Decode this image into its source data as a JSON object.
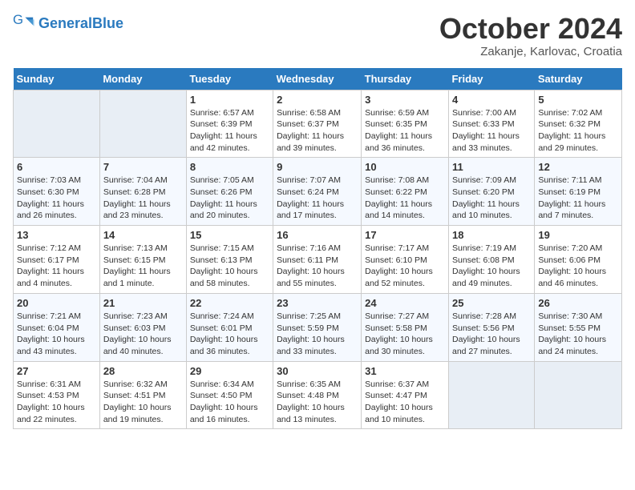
{
  "header": {
    "logo_general": "General",
    "logo_blue": "Blue",
    "month": "October 2024",
    "location": "Zakanje, Karlovac, Croatia"
  },
  "days_of_week": [
    "Sunday",
    "Monday",
    "Tuesday",
    "Wednesday",
    "Thursday",
    "Friday",
    "Saturday"
  ],
  "weeks": [
    [
      {
        "day": "",
        "info": ""
      },
      {
        "day": "",
        "info": ""
      },
      {
        "day": "1",
        "info": "Sunrise: 6:57 AM\nSunset: 6:39 PM\nDaylight: 11 hours and 42 minutes."
      },
      {
        "day": "2",
        "info": "Sunrise: 6:58 AM\nSunset: 6:37 PM\nDaylight: 11 hours and 39 minutes."
      },
      {
        "day": "3",
        "info": "Sunrise: 6:59 AM\nSunset: 6:35 PM\nDaylight: 11 hours and 36 minutes."
      },
      {
        "day": "4",
        "info": "Sunrise: 7:00 AM\nSunset: 6:33 PM\nDaylight: 11 hours and 33 minutes."
      },
      {
        "day": "5",
        "info": "Sunrise: 7:02 AM\nSunset: 6:32 PM\nDaylight: 11 hours and 29 minutes."
      }
    ],
    [
      {
        "day": "6",
        "info": "Sunrise: 7:03 AM\nSunset: 6:30 PM\nDaylight: 11 hours and 26 minutes."
      },
      {
        "day": "7",
        "info": "Sunrise: 7:04 AM\nSunset: 6:28 PM\nDaylight: 11 hours and 23 minutes."
      },
      {
        "day": "8",
        "info": "Sunrise: 7:05 AM\nSunset: 6:26 PM\nDaylight: 11 hours and 20 minutes."
      },
      {
        "day": "9",
        "info": "Sunrise: 7:07 AM\nSunset: 6:24 PM\nDaylight: 11 hours and 17 minutes."
      },
      {
        "day": "10",
        "info": "Sunrise: 7:08 AM\nSunset: 6:22 PM\nDaylight: 11 hours and 14 minutes."
      },
      {
        "day": "11",
        "info": "Sunrise: 7:09 AM\nSunset: 6:20 PM\nDaylight: 11 hours and 10 minutes."
      },
      {
        "day": "12",
        "info": "Sunrise: 7:11 AM\nSunset: 6:19 PM\nDaylight: 11 hours and 7 minutes."
      }
    ],
    [
      {
        "day": "13",
        "info": "Sunrise: 7:12 AM\nSunset: 6:17 PM\nDaylight: 11 hours and 4 minutes."
      },
      {
        "day": "14",
        "info": "Sunrise: 7:13 AM\nSunset: 6:15 PM\nDaylight: 11 hours and 1 minute."
      },
      {
        "day": "15",
        "info": "Sunrise: 7:15 AM\nSunset: 6:13 PM\nDaylight: 10 hours and 58 minutes."
      },
      {
        "day": "16",
        "info": "Sunrise: 7:16 AM\nSunset: 6:11 PM\nDaylight: 10 hours and 55 minutes."
      },
      {
        "day": "17",
        "info": "Sunrise: 7:17 AM\nSunset: 6:10 PM\nDaylight: 10 hours and 52 minutes."
      },
      {
        "day": "18",
        "info": "Sunrise: 7:19 AM\nSunset: 6:08 PM\nDaylight: 10 hours and 49 minutes."
      },
      {
        "day": "19",
        "info": "Sunrise: 7:20 AM\nSunset: 6:06 PM\nDaylight: 10 hours and 46 minutes."
      }
    ],
    [
      {
        "day": "20",
        "info": "Sunrise: 7:21 AM\nSunset: 6:04 PM\nDaylight: 10 hours and 43 minutes."
      },
      {
        "day": "21",
        "info": "Sunrise: 7:23 AM\nSunset: 6:03 PM\nDaylight: 10 hours and 40 minutes."
      },
      {
        "day": "22",
        "info": "Sunrise: 7:24 AM\nSunset: 6:01 PM\nDaylight: 10 hours and 36 minutes."
      },
      {
        "day": "23",
        "info": "Sunrise: 7:25 AM\nSunset: 5:59 PM\nDaylight: 10 hours and 33 minutes."
      },
      {
        "day": "24",
        "info": "Sunrise: 7:27 AM\nSunset: 5:58 PM\nDaylight: 10 hours and 30 minutes."
      },
      {
        "day": "25",
        "info": "Sunrise: 7:28 AM\nSunset: 5:56 PM\nDaylight: 10 hours and 27 minutes."
      },
      {
        "day": "26",
        "info": "Sunrise: 7:30 AM\nSunset: 5:55 PM\nDaylight: 10 hours and 24 minutes."
      }
    ],
    [
      {
        "day": "27",
        "info": "Sunrise: 6:31 AM\nSunset: 4:53 PM\nDaylight: 10 hours and 22 minutes."
      },
      {
        "day": "28",
        "info": "Sunrise: 6:32 AM\nSunset: 4:51 PM\nDaylight: 10 hours and 19 minutes."
      },
      {
        "day": "29",
        "info": "Sunrise: 6:34 AM\nSunset: 4:50 PM\nDaylight: 10 hours and 16 minutes."
      },
      {
        "day": "30",
        "info": "Sunrise: 6:35 AM\nSunset: 4:48 PM\nDaylight: 10 hours and 13 minutes."
      },
      {
        "day": "31",
        "info": "Sunrise: 6:37 AM\nSunset: 4:47 PM\nDaylight: 10 hours and 10 minutes."
      },
      {
        "day": "",
        "info": ""
      },
      {
        "day": "",
        "info": ""
      }
    ]
  ]
}
